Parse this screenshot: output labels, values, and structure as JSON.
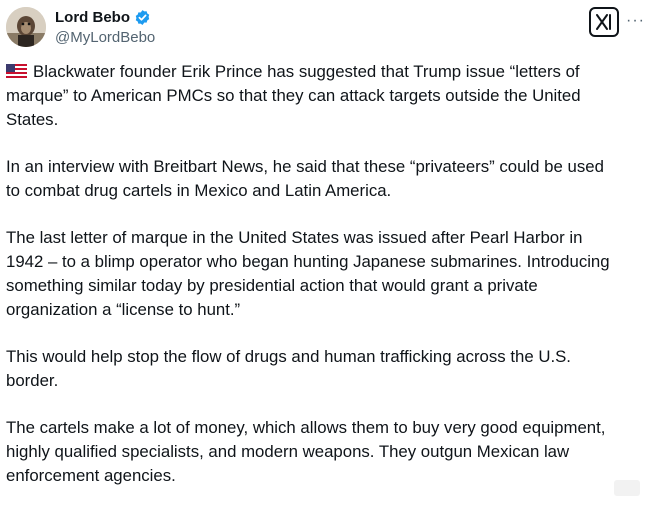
{
  "author": {
    "display_name": "Lord Bebo",
    "handle": "@MyLordBebo",
    "verified": true
  },
  "icons": {
    "avatar": "avatar-icon",
    "verified": "verified-badge-icon",
    "grok": "grok-icon",
    "more": "more-options-icon",
    "flag": "us-flag-icon"
  },
  "colors": {
    "verified_blue": "#1d9bf0",
    "text": "#0f1419",
    "muted": "#536471"
  },
  "tweet": {
    "paragraphs": [
      "Blackwater founder Erik Prince has suggested that Trump issue “letters of\nmarque” to American PMCs so that they can attack targets outside the United\nStates.",
      "In an interview with Breitbart News, he said that these “privateers” could be used\nto combat drug cartels in Mexico and Latin America.",
      "The last letter of marque in the United States was issued after Pearl Harbor in\n1942 – to a blimp operator who began hunting Japanese submarines. Introducing\nsomething similar today by presidential action that would grant a private\norganization a “license to hunt.”",
      "This would help stop the flow of drugs and human trafficking across the U.S.\nborder.",
      "The cartels make a lot of money, which allows them to buy very good equipment,\nhighly qualified specialists, and modern weapons. They outgun Mexican law\nenforcement agencies."
    ]
  },
  "more_label": "···"
}
